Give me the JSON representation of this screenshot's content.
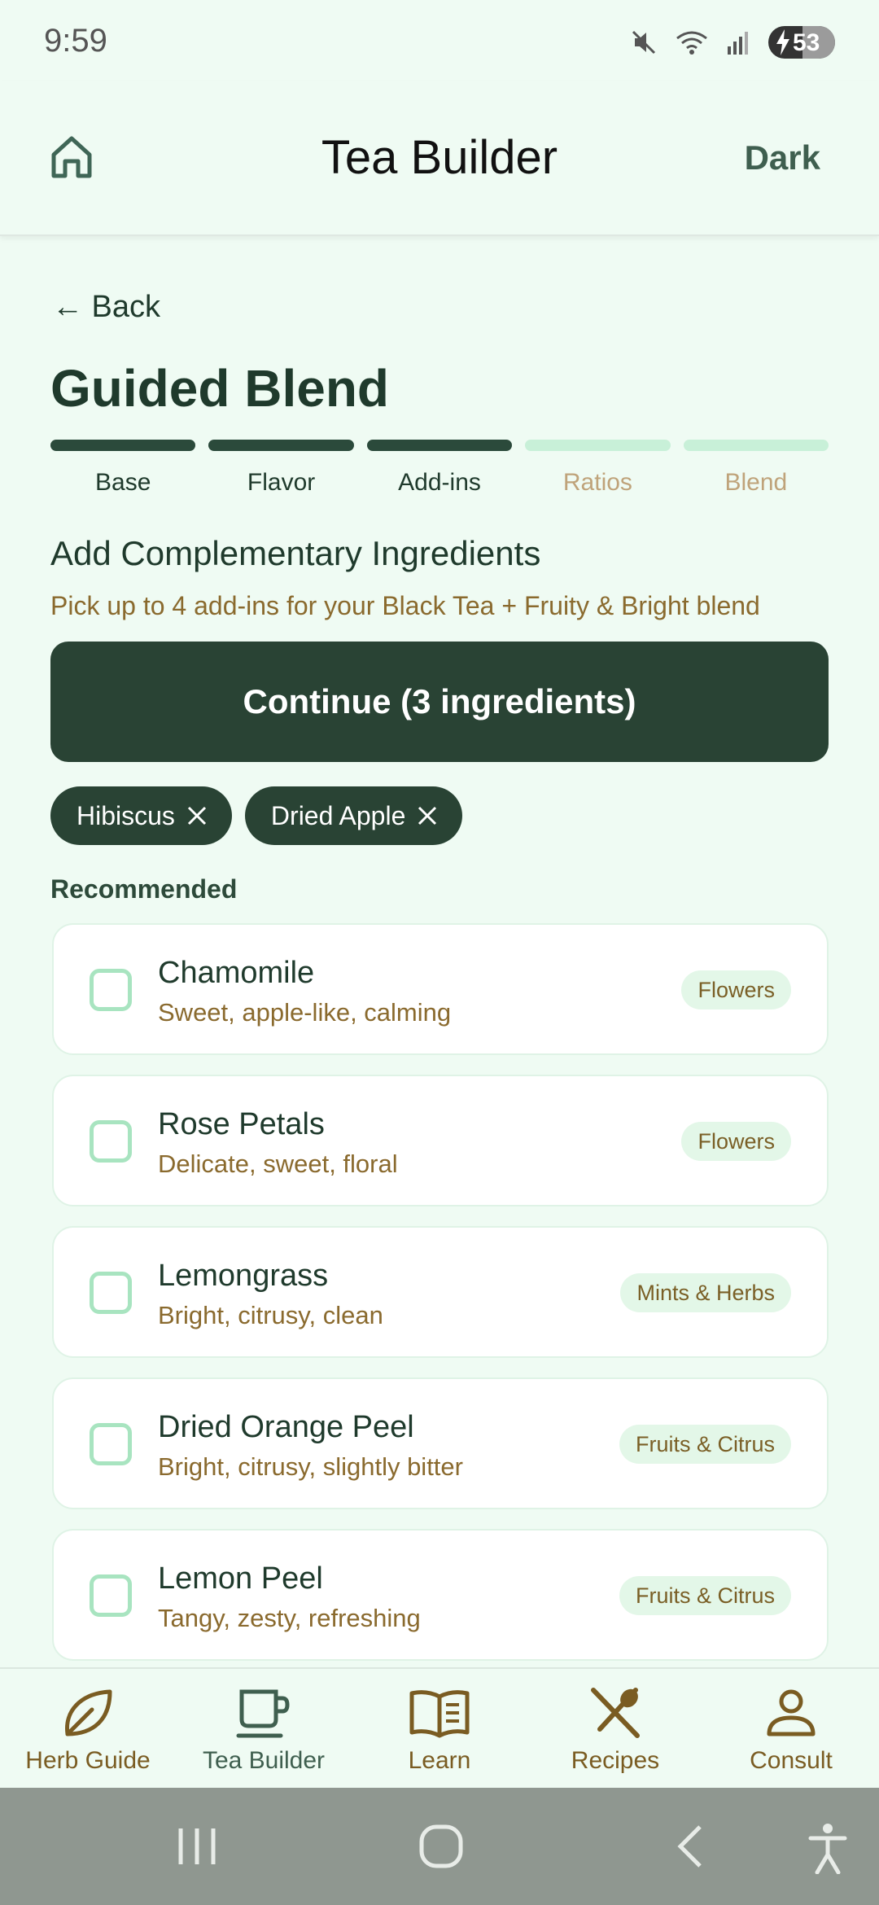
{
  "status_bar": {
    "time": "9:59",
    "battery": "53"
  },
  "header": {
    "title": "Tea Builder",
    "theme_toggle": "Dark"
  },
  "back_label": "← Back",
  "page_title": "Guided Blend",
  "steps": [
    {
      "label": "Base",
      "state": "done"
    },
    {
      "label": "Flavor",
      "state": "done"
    },
    {
      "label": "Add-ins",
      "state": "current"
    },
    {
      "label": "Ratios",
      "state": "pending"
    },
    {
      "label": "Blend",
      "state": "pending"
    }
  ],
  "section": {
    "title": "Add Complementary Ingredients",
    "subtitle": "Pick up to 4 add-ins for your Black Tea + Fruity & Bright blend"
  },
  "continue_label": "Continue (3 ingredients)",
  "selected_chips": [
    {
      "label": "Hibiscus"
    },
    {
      "label": "Dried Apple"
    }
  ],
  "recommended_label": "Recommended",
  "ingredients": [
    {
      "name": "Chamomile",
      "description": "Sweet, apple-like, calming",
      "category": "Flowers",
      "checked": false
    },
    {
      "name": "Rose Petals",
      "description": "Delicate, sweet, floral",
      "category": "Flowers",
      "checked": false
    },
    {
      "name": "Lemongrass",
      "description": "Bright, citrusy, clean",
      "category": "Mints & Herbs",
      "checked": false
    },
    {
      "name": "Dried Orange Peel",
      "description": "Bright, citrusy, slightly bitter",
      "category": "Fruits & Citrus",
      "checked": false
    },
    {
      "name": "Lemon Peel",
      "description": "Tangy, zesty, refreshing",
      "category": "Fruits & Citrus",
      "checked": false
    }
  ],
  "bottom_nav": [
    {
      "label": "Herb Guide",
      "icon": "leaf-icon",
      "active": false
    },
    {
      "label": "Tea Builder",
      "icon": "cup-icon",
      "active": true
    },
    {
      "label": "Learn",
      "icon": "book-icon",
      "active": false
    },
    {
      "label": "Recipes",
      "icon": "utensils-icon",
      "active": false
    },
    {
      "label": "Consult",
      "icon": "person-icon",
      "active": false
    }
  ],
  "colors": {
    "primary": "#294334",
    "background": "#effbf3",
    "accent_text": "#8a6a2e",
    "pending_step": "#c8f0d8"
  }
}
